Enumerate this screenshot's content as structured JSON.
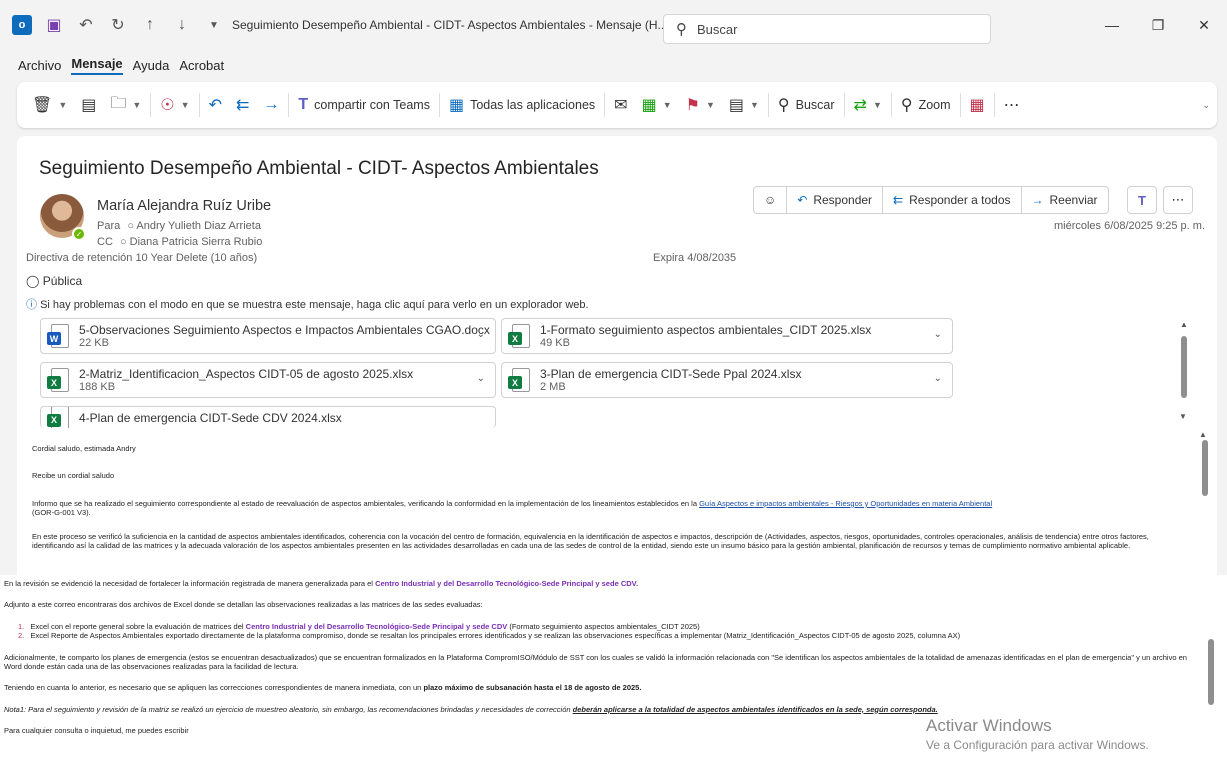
{
  "window": {
    "title": "Seguimiento Desempeño Ambiental - CIDT- Aspectos Ambientales  -  Mensaje (H...",
    "search_placeholder": "Buscar"
  },
  "menu": [
    "Archivo",
    "Mensaje",
    "Ayuda",
    "Acrobat"
  ],
  "ribbon": {
    "teams": "compartir con Teams",
    "apps": "Todas las aplicaciones",
    "buscar": "Buscar",
    "zoom": "Zoom"
  },
  "message": {
    "subject": "Seguimiento Desempeño Ambiental - CIDT- Aspectos Ambientales",
    "sender": "María Alejandra Ruíz Uribe",
    "to_label": "Para",
    "to": "Andry Yulieth Diaz Arrieta",
    "cc_label": "CC",
    "cc": "Diana Patricia Sierra Rubio",
    "retention": "Directiva de retención  10 Year Delete (10 años)",
    "expires": "Expira  4/08/2035",
    "sensitivity": "Pública",
    "info_bar": "Si hay problemas con el modo en que se muestra este mensaje, haga clic aquí para verlo en un explorador web.",
    "date": "miércoles 6/08/2025 9:25 p. m.",
    "actions": {
      "reply": "Responder",
      "reply_all": "Responder a todos",
      "forward": "Reenviar"
    }
  },
  "attachments": [
    {
      "name": "5-Observaciones Seguimiento Aspectos e Impactos Ambientales CGAO.docx",
      "size": "22 KB",
      "type": "word"
    },
    {
      "name": "1-Formato seguimiento aspectos ambientales_CIDT 2025.xlsx",
      "size": "49 KB",
      "type": "excel"
    },
    {
      "name": "2-Matriz_Identificacion_Aspectos CIDT-05 de agosto 2025.xlsx",
      "size": "188 KB",
      "type": "excel"
    },
    {
      "name": "3-Plan de emergencia CIDT-Sede Ppal 2024.xlsx",
      "size": "2 MB",
      "type": "excel"
    },
    {
      "name": "4-Plan de emergencia CIDT-Sede CDV 2024.xlsx",
      "size": "",
      "type": "excel"
    }
  ],
  "body": {
    "greeting": "Cordial saludo, estimada Andry",
    "p1": "Recibe un cordial saludo",
    "p2a": "Informo que se ha realizado el seguimiento correspondiente al estado de reevaluación de aspectos ambientales, verificando la conformidad en la implementación de los lineamientos establecidos en la ",
    "p2link": "Guía Aspectos e impactos ambientales - Riesgos y Oportunidades en materia Ambiental",
    "p2b": "(GOR-G-001 V3).",
    "p3": "En este proceso se verificó la suficiencia en la cantidad de aspectos ambientales identificados, coherencia con la vocación del centro de formación, equivalencia en la identificación de aspectos e impactos, descripción de (Actividades, aspectos, riesgos, oportunidades, controles operacionales, análisis de tendencia) entre otros factores, identificando así la calidad de las matrices y la adecuada valoración de los aspectos ambientales presenten en las actividades desarrolladas en cada una de las sedes de control de la entidad, siendo este un insumo básico para la gestión ambiental, planificación de recursos y temas de cumplimiento normativo ambiental aplicable.",
    "p4a": "En la revisión se evidenció la necesidad de fortalecer la información registrada de manera generalizada para el ",
    "p4b": "Centro Industrial y del Desarrollo Tecnológico-Sede Principal y sede CDV.",
    "p5": "Adjunto a este correo encontraras dos archivos de Excel donde se detallan las observaciones realizadas a las matrices de las sedes evaluadas:",
    "li1a": "Excel con el reporte general sobre la evaluación de matrices del ",
    "li1b": "Centro Industrial y del Desarrollo Tecnológico-Sede Principal y sede CDV",
    "li1c": " (Formato seguimiento aspectos ambientales_CIDT  2025)",
    "li2": "Excel Reporte de Aspectos Ambientales exportado directamente de la plataforma compromiso, donde se resaltan los principales errores identificados y se realizan las observaciones específicas a implementar (Matriz_Identificación_Aspectos CIDT-05 de agosto 2025,  columna AX)",
    "p6": "Adicionalmente, te comparto los planes de emergencia (estos se encuentran desactualizados) que se encuentran formalizados en la Plataforma CompromISO/Módulo de SST con los cuales se validó la información relacionada con \"Se identifican los aspectos ambientales de la totalidad de amenazas identificadas en el plan de emergencia\" y un archivo en Word donde están cada una de las observaciones realizadas para la facilidad de lectura.",
    "p7a": "Teniendo en cuanta lo anterior, es necesario que se apliquen las correcciones correspondientes de manera inmediata, con un ",
    "p7b": "plazo máximo de subsanación hasta el 18 de agosto de 2025.",
    "p8a": "Nota1: Para el seguimiento y revisión de la matriz se realizó un ejercicio de muestreo aleatorio, sin embargo, las recomendaciones brindadas y necesidades de corrección ",
    "p8b": "deberán aplicarse a la totalidad de aspectos ambientales identificados en la sede, según corresponda.",
    "p9": "Para cualquier consulta o inquietud, me puedes escribir"
  },
  "watermark": {
    "line1": "Activar Windows",
    "line2": "Ve a Configuración para activar Windows."
  }
}
